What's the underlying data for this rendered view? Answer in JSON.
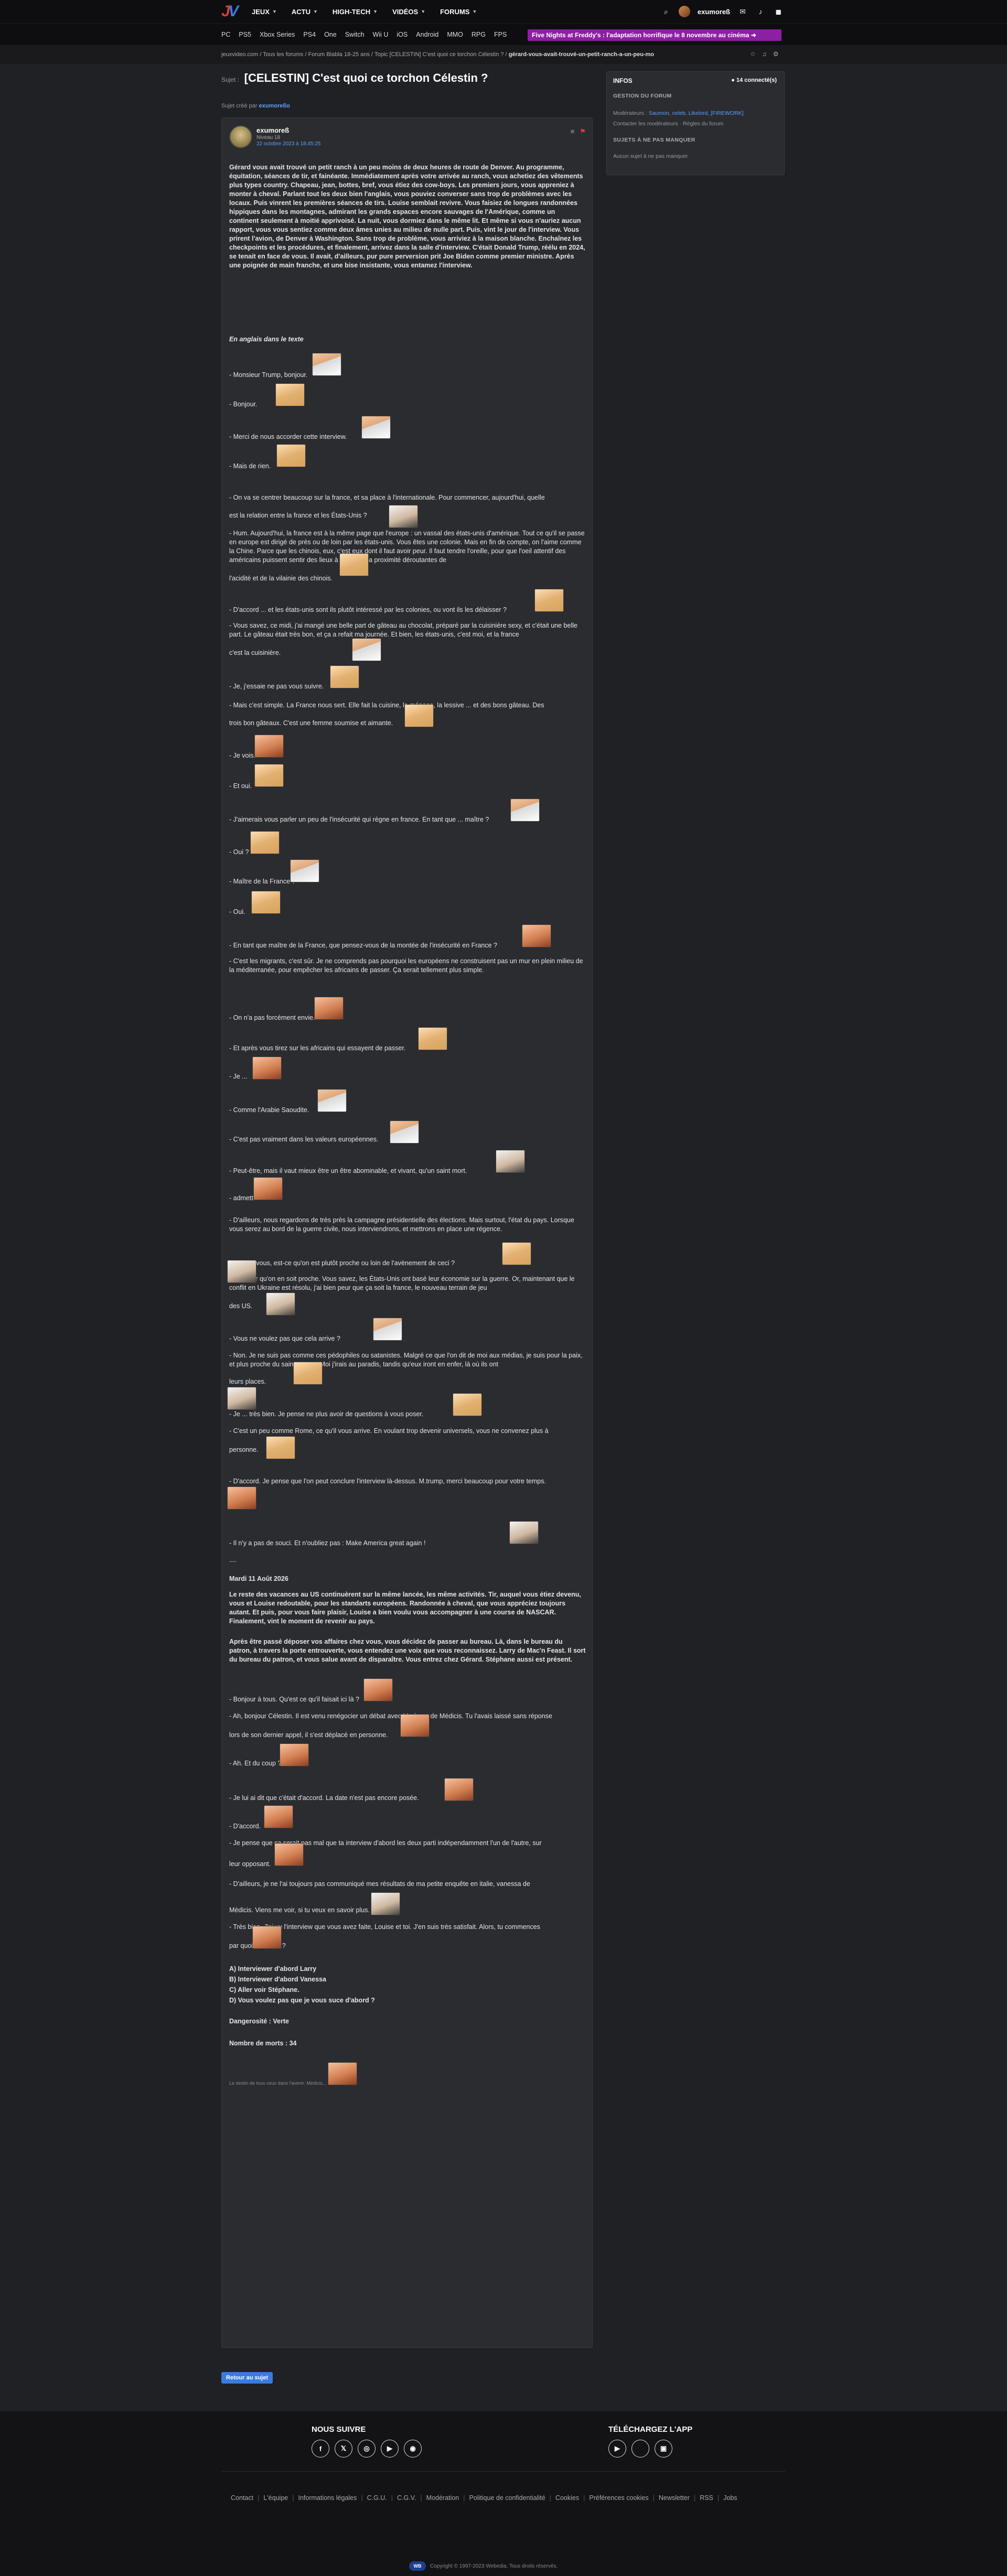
{
  "header": {
    "logo_letters": [
      "J",
      "V"
    ],
    "nav": [
      "JEUX",
      "ACTU",
      "HIGH-TECH",
      "VIDÉOS",
      "FORUMS"
    ],
    "username": "exumoreß",
    "icons": [
      "search-icon",
      "mail-icon",
      "bell-icon",
      "notification-icon"
    ]
  },
  "subnav": {
    "items": [
      "PC",
      "PS5",
      "Xbox Series",
      "PS4",
      "One",
      "Switch",
      "Wii U",
      "iOS",
      "Android",
      "MMO",
      "RPG",
      "FPS"
    ],
    "promo": "Five Nights at Freddy's : l'adaptation horrifique le 8 novembre au cinéma ➜"
  },
  "breadcrumb": {
    "root": "jeuxvideo.com / Tous les forums / Forum Blabla 18-25 ans / Topic [CELESTIN] C'est quoi ce torchon Célestin ? /",
    "current": "gérard-vous-avait-trouvé-un-petit-ranch-a-un-peu-mo"
  },
  "topic": {
    "sujet_label": "Sujet :",
    "title": "[CELESTIN] C'est quoi ce torchon Célestin ?",
    "created_prefix": "Sujet créé par",
    "created_by": "exumoreßo"
  },
  "post": {
    "author": "exumoreß",
    "level": "Niveau 18",
    "date": "22 octobre 2023 à 18:45:25",
    "intro": "Gérard vous avait trouvé un petit ranch à un peu moins de deux heures de route de Denver. Au programme, équitation, séances de tir, et fainéante. Immédiatement après votre arrivée au ranch, vous achetiez des vêtements plus types country. Chapeau, jean, bottes, bref, vous étiez des cow-boys. Les premiers jours, vous appreniez à monter à cheval. Parlant tout les deux bien l'anglais, vous pouviez converser sans trop de problèmes avec les locaux. Puis vinrent les premières séances de tirs. Louise semblait revivre. Vous faisiez de longues randonnées hippiques dans les montagnes, admirant les grands espaces encore sauvages de l'Amérique, comme un continent seulement à moitié apprivoisé. La nuit, vous dormiez dans le même lit. Et même si vous n'auriez aucun rapport, vous vous sentiez comme deux âmes unies au milieu de nulle part. Puis, vint le jour de l'interview. Vous prirent l'avion, de Denver à Washington. Sans trop de problème, vous arriviez à la maison blanche. Enchaînez les checkpoints et les procédures, et finalement, arrivez dans la salle d'interview. C'était Donald Trump, réélu en 2024, se tenait en face de vous. Il avait, d'ailleurs, pur pure perversion prit Joe Biden comme premier ministre. Après une poignée de main franche, et une bise insistante, vous entamez l'interview.",
    "english_header": "En anglais dans le texte",
    "lines": [
      "- Monsieur Trump, bonjour.",
      "- Bonjour.",
      "- Merci de nous accorder cette interview.",
      "- Mais de rien.",
      "- On va se centrer beaucoup sur la france, et sa place à l'internationale. Pour commencer, aujourd'hui, quelle",
      "est la relation entre la france et les États-Unis ?",
      "- Hum. Aujourd'hui, la france est à la même page que l'europe : un vassal des états-unis d'amérique. Tout ce qu'il se passe en europe est dirigé de près ou de loin par les états-unis. Vous êtes une colonie. Mais en fin de compte, on l'aime comme la Chine. Parce que les chinois, eux, c'est eux dont il faut avoir peur. Il faut tendre l'oreille, pour que l'oeil attentif des américains puissent sentir des lieux à la ronde, la proximité déroutantes de",
      "l'acidité et de la vilainie des chinois.",
      "- D'accord ... et les états-unis sont ils plutôt intéressé par les colonies, ou vont ils les délaisser ?",
      "- Vous savez, ce midi, j'ai mangé une belle part de gâteau au chocolat, préparé par la cuisinière sexy, et c'était une belle part. Le gâteau était très bon, et ça a refait ma journée. Et bien, les états-unis, c'est moi, et la france",
      "c'est la cuisinière.",
      "- Je, j'essaie ne pas vous suivre.",
      "- Mais c'est simple. La France nous sert. Elle fait la cuisine, le ménage, la lessive ... et des bons gâteau. Des",
      "trois bon gâteaux. C'est une femme soumise et aimante.",
      "- Je vois.",
      "- Et oui.",
      "- J'aimerais vous parler un peu de l'insécurité qui règne en france. En tant que ... maître ?",
      "- Oui ?",
      "- Maître de la France ?",
      "- Oui.",
      "- En tant que maître de la France, que pensez-vous de la montée de l'insécurité en France ?",
      "- C'est les migrants, c'est sûr. Je ne comprends pas pourquoi les européens ne construisent pas un mur en plein milieu de la méditerranée, pour empêcher les africains de passer. Ça serait tellement plus simple.",
      "- On n'a pas forcément envie.",
      "- Et après vous tirez sur les africains qui essayent de passer.",
      "- Je ...",
      "- Comme l'Arabie Saoudite.",
      "- C'est pas vraiment dans les valeurs européennes.",
      "- Peut-être, mais il vaut mieux être un être abominable, et vivant, qu'un saint mort.",
      "- admettons.",
      "- D'ailleurs, nous regardons de très près la campagne présidentielle des élections. Mais surtout, l'état du pays. Lorsque vous serez au bord de la guerre civile, nous interviendrons, et mettrons en place une régence.",
      "- Et pour vous, est-ce qu'on est plutôt proche ou loin de l'avènement de ceci ?",
      "- J'ai peur qu'on en soit proche. Vous savez, les États-Unis ont basé leur économie sur la guerre. Or, maintenant que le conflit en Ukraine est résolu, j'ai bien peur que ça soit la france, le nouveau terrain de jeu",
      "des US.",
      "- Vous ne voulez pas que cela arrive ?",
      "- Non. Je ne suis pas comme ces pédophiles ou satanistes. Malgré ce que l'on dit de moi aux médias, je suis pour la paix, et plus proche du saint qu'eux. Moi j'irais au paradis, tandis qu'eux iront en enfer, là où ils ont",
      "leurs places.",
      "- Je ... très bien. Je pense ne plus avoir de questions à vous poser.",
      "- C'est un peu comme Rome, ce qu'il vous arrive. En voulant trop devenir universels, vous ne convenez plus à",
      "personne.",
      "- D'accord. Je pense que l'on peut conclure l'interview là-dessus. M.trump, merci beaucoup pour votre temps.",
      "- Il n'y a pas de souci. Et n'oubliez pas : Make America great again !",
      "...."
    ],
    "date_header": "Mardi 11 Août 2026",
    "para2": "Le reste des vacances au US continuèrent sur la même lancée, les même activités. Tir, auquel vous étiez devenu, vous et Louise redoutable, pour les standarts européens. Randonnée à cheval, que vous appréciez toujours autant. Et puis, pour vous faire plaisir, Louise a bien voulu vous accompagner à une course de NASCAR. Finalement, vint le moment de revenir au pays.",
    "para3": "Après être passé déposer vos affaires chez vous, vous décidez de passer au bureau. Là, dans le bureau du patron, à travers la porte entrouverte, vous entendez une voix que vous reconnaissez. Larry de Mac'n Feast. Il sort du bureau du patron, et vous salue avant de disparaître. Vous entrez chez Gérard. Stéphane aussi est présent.",
    "lines2": [
      "- Bonjour à tous. Qu'est ce qu'il faisait ici là ?",
      "- Ah, bonjour Célestin. Il est venu renégocier un débat avec Madame de Médicis. Tu l'avais laissé sans réponse",
      "lors de son dernier appel, il s'est déplacé en personne.",
      "- Ah. Et du coup ?",
      "- Je lui ai dit que c'était d'accord. La date n'est pas encore posée.",
      "- D'accord.",
      "- Je pense que ça serait pas mal que ta interview d'abord les deux parti indépendamment l'un de l'autre, sur",
      "leur opposant.",
      "- D'ailleurs, je ne l'ai toujours pas communiqué mes résultats de ma petite enquête en italie, vanessa de",
      "Médicis. Viens me voir, si tu veux en savoir plus.",
      "- Très bien. J'ai vu l'interview que vous avez faite, Louise et toi. J'en suis très satisfait. Alors, tu commences",
      "par quoi, Célestin ?"
    ],
    "choices": [
      "A) Interviewer d'abord Larry",
      "B) Interviewer d'abord Vanessa",
      "C) Aller voir Stéphane.",
      "D) Vous voulez pas que je vous suce d'abord ?"
    ],
    "danger": "Dangerosité : Verte",
    "deaths": "Nombre de morts : 34",
    "signature": "Le destin de tous ceux dans l'avenir. Médicis..."
  },
  "footer_btn": "Retour au sujet",
  "sidebar": {
    "title": "INFOS",
    "connected": "14 connecté(s)",
    "sec1": "GESTION DU FORUM",
    "moderators_label": "Modérateurs :",
    "moderators": "Saumon, celeb, Likelord, [FIREWORK]",
    "contact": "Contacter les modérateurs · Règles du forum",
    "sec2": "SUJETS À NE PAS MANQUER",
    "none": "Aucun sujet à ne pas manquer"
  },
  "footer": {
    "follow": "NOUS SUIVRE",
    "download": "TÉLÉCHARGEZ L'APP",
    "social": [
      "f",
      "𝕏",
      "◎",
      "▶",
      "◉"
    ],
    "stores": [
      "▶",
      "",
      "▣"
    ],
    "links": [
      "Contact",
      "L'équipe",
      "Informations légales",
      "C.G.U.",
      "C.G.V.",
      "Modération",
      "Politique de confidentialité",
      "Cookies",
      "Préférences cookies",
      "Newsletter",
      "RSS",
      "Jobs"
    ],
    "brand": "WB",
    "copyright": "Copyright © 1997-2023 Webedia. Tous droits réservés."
  }
}
